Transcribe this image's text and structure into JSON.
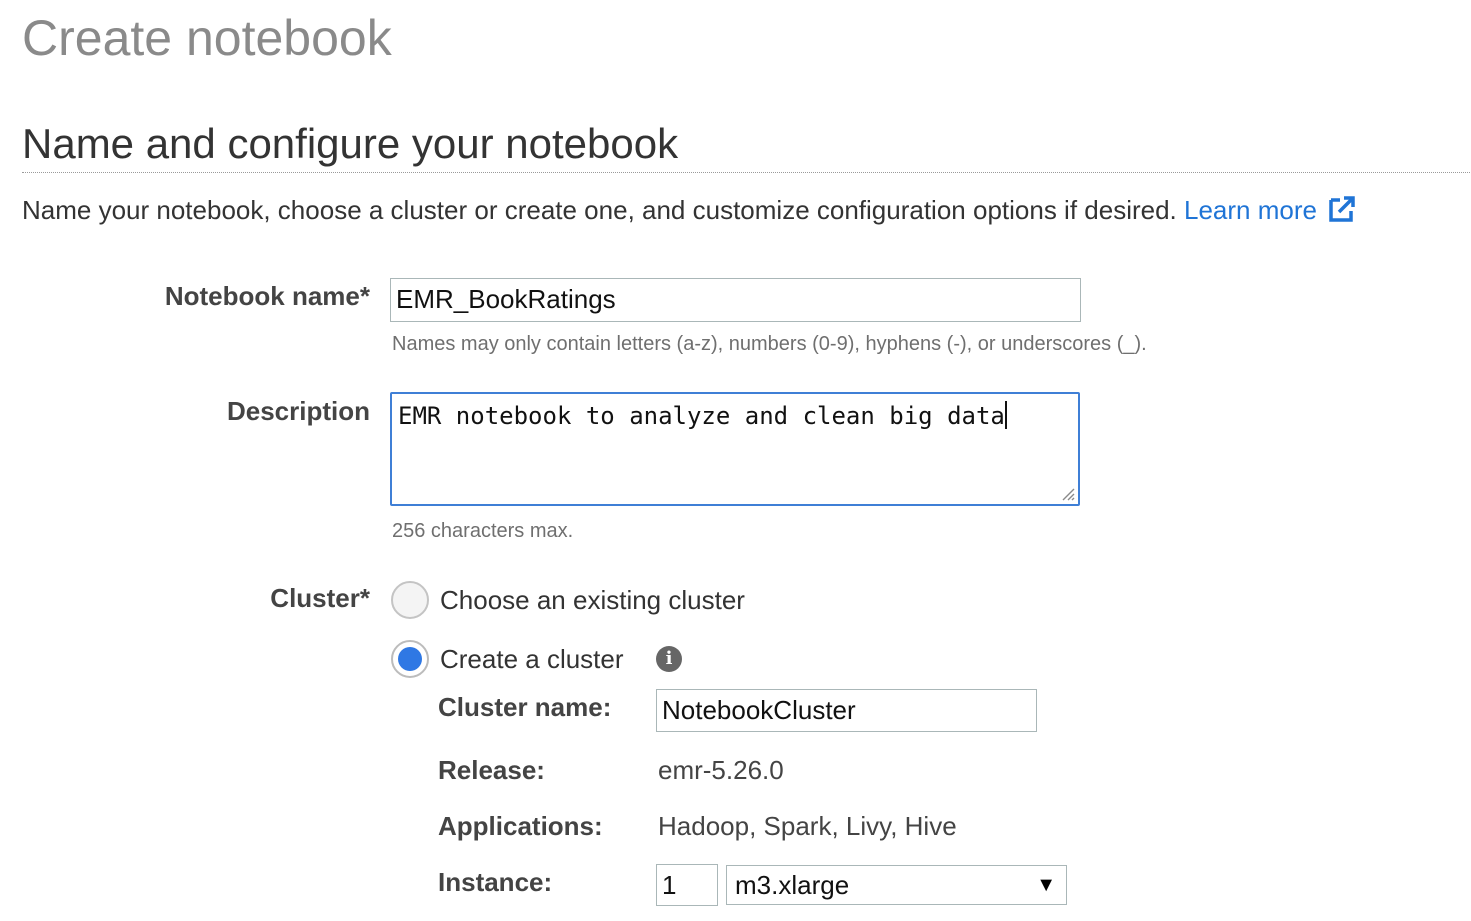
{
  "header": {
    "title": "Create notebook",
    "section_title": "Name and configure your notebook",
    "intro_text": "Name your notebook, choose a cluster or create one, and customize configuration options if desired.",
    "learn_more": "Learn more",
    "learn_more_icon": "external-link-icon"
  },
  "form": {
    "notebook_name": {
      "label": "Notebook name*",
      "value": "EMR_BookRatings",
      "hint": "Names may only contain letters (a-z), numbers (0-9), hyphens (-), or underscores (_)."
    },
    "description": {
      "label": "Description",
      "value": "EMR notebook to analyze and clean big data",
      "hint": "256 characters max."
    },
    "cluster": {
      "label": "Cluster*",
      "option_existing": "Choose an existing cluster",
      "option_create": "Create a cluster",
      "selected": "create",
      "info_icon": "info-icon",
      "cluster_name_label": "Cluster name:",
      "cluster_name_value": "NotebookCluster",
      "release_label": "Release:",
      "release_value": "emr-5.26.0",
      "applications_label": "Applications:",
      "applications_value": "Hadoop, Spark, Livy, Hive",
      "instance_label": "Instance:",
      "instance_count": "1",
      "instance_type": "m3.xlarge"
    }
  },
  "colors": {
    "link": "#1f74d6",
    "focus_border": "#3f7fd6",
    "radio_selected": "#2f78e4"
  }
}
